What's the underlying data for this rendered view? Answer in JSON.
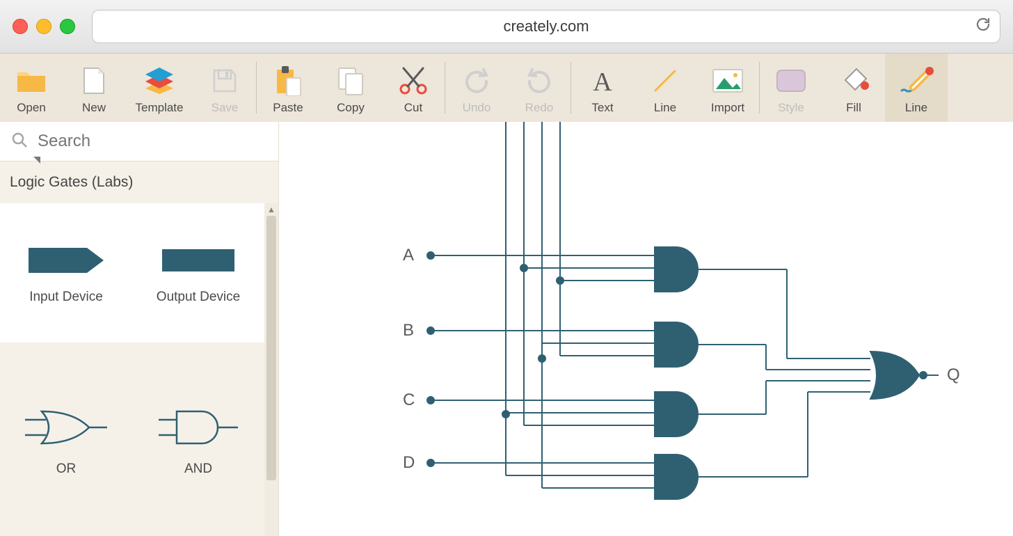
{
  "browser": {
    "url": "creately.com"
  },
  "toolbar": {
    "open": "Open",
    "new": "New",
    "template": "Template",
    "save": "Save",
    "paste": "Paste",
    "copy": "Copy",
    "cut": "Cut",
    "undo": "Undo",
    "redo": "Redo",
    "text": "Text",
    "line": "Line",
    "import": "Import",
    "style": "Style",
    "fill": "Fill",
    "line2": "Line"
  },
  "sidebar": {
    "search_placeholder": "Search",
    "category": "Logic Gates (Labs)",
    "tiles": {
      "input": "Input Device",
      "output": "Output Device",
      "or": "OR",
      "and": "AND"
    }
  },
  "canvas": {
    "labels": {
      "a": "A",
      "b": "B",
      "c": "C",
      "d": "D",
      "q": "Q"
    }
  }
}
